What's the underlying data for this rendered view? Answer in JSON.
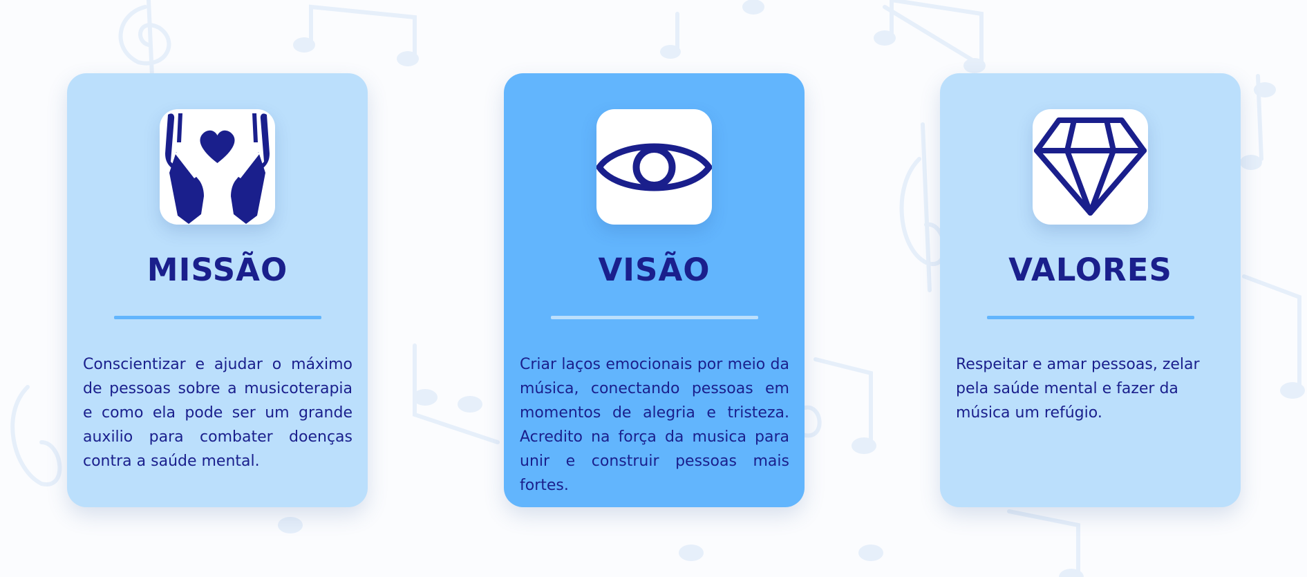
{
  "background": {
    "color": "#fbfcfe",
    "pattern": "music-notes"
  },
  "colors": {
    "card_light": "#bbdffc",
    "card_accent": "#62b5fd",
    "text_primary": "#1a1f8c",
    "icon_box": "#ffffff"
  },
  "cards": [
    {
      "icon": "hands-heart-icon",
      "title": "MISSÃO",
      "text": "Conscientizar e ajudar o máximo de pessoas sobre a musicoterapia e como ela pode ser um grande auxilio para combater doenças contra a saúde mental."
    },
    {
      "icon": "eye-icon",
      "title": "VISÃO",
      "text": "Criar laços emocionais por meio da música, conectando pessoas em momentos de alegria e tristeza. Acredito na força da musica para unir e construir pessoas mais fortes."
    },
    {
      "icon": "diamond-icon",
      "title": "VALORES",
      "text": "Respeitar e amar pessoas, zelar pela saúde mental e fazer da música um refúgio."
    }
  ]
}
